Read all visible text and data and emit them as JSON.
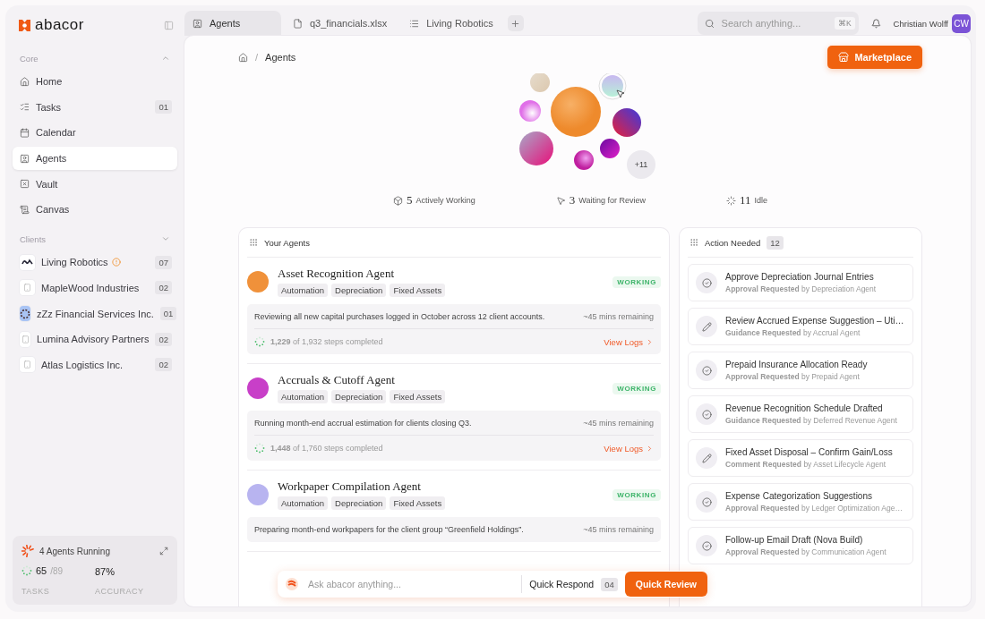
{
  "brand": {
    "name": "abacor"
  },
  "sidebar": {
    "sections": [
      {
        "title": "Core",
        "expanded": true,
        "items": [
          {
            "kind": "home",
            "label": "Home",
            "selected": false
          },
          {
            "kind": "tasks",
            "label": "Tasks",
            "count": "01",
            "selected": false
          },
          {
            "kind": "calendar",
            "label": "Calendar",
            "selected": false
          },
          {
            "kind": "agents",
            "label": "Agents",
            "selected": true
          },
          {
            "kind": "vault",
            "label": "Vault",
            "selected": false
          },
          {
            "kind": "canvas",
            "label": "Canvas",
            "selected": false
          }
        ]
      },
      {
        "title": "Clients",
        "expanded": false,
        "items": [
          {
            "kind": "wave",
            "label": "Living Robotics",
            "alert": true,
            "count": "07",
            "selected": false
          },
          {
            "kind": "building",
            "label": "MapleWood Industries",
            "alert": false,
            "count": "02",
            "selected": false
          },
          {
            "kind": "brand",
            "label": "zZz Financial Services Inc.",
            "alert": false,
            "count": "01",
            "selected": false
          },
          {
            "kind": "building",
            "label": "Lumina Advisory Partners",
            "alert": false,
            "count": "02",
            "selected": false
          },
          {
            "kind": "building",
            "label": "Atlas Logistics Inc.",
            "alert": false,
            "count": "02",
            "selected": false
          }
        ]
      }
    ],
    "running": {
      "title": "4 Agents Running",
      "tasks_done": "65",
      "tasks_total": "/89",
      "tasks_label": "TASKS",
      "accuracy": "87%",
      "accuracy_label": "ACCURACY"
    }
  },
  "tabs": [
    {
      "kind": "agents",
      "label": "Agents",
      "selected": true
    },
    {
      "kind": "file",
      "label": "q3_financials.xlsx",
      "selected": false
    },
    {
      "kind": "list",
      "label": "Living Robotics",
      "selected": false
    }
  ],
  "search": {
    "placeholder": "Search anything...",
    "shortcut": "⌘K"
  },
  "user": {
    "name": "Christian Wolff",
    "initials": "CW"
  },
  "breadcrumb": {
    "separator": "/",
    "items": [
      "Agents"
    ]
  },
  "marketplace_button": "Marketplace",
  "cluster": {
    "more": "+11"
  },
  "stats": [
    {
      "kind": "working",
      "count": "5",
      "label": "Actively Working"
    },
    {
      "kind": "review",
      "count": "3",
      "label": "Waiting for Review"
    },
    {
      "kind": "idle",
      "count": "11",
      "label": "Idle"
    }
  ],
  "agents_panel": {
    "title": "Your Agents",
    "agents": [
      {
        "name": "Asset Recognition Agent",
        "color": "#f0913a",
        "tags": [
          "Automation",
          "Depreciation",
          "Fixed Assets"
        ],
        "status": "WORKING",
        "description": "Reviewing all new capital purchases logged in October across 12 client accounts.",
        "remaining": "~45 mins remaining",
        "steps": "**1,229** of 1,932 steps completed",
        "link": "View Logs"
      },
      {
        "name": "Accruals & Cutoff Agent",
        "color": "#c83fc8",
        "tags": [
          "Automation",
          "Depreciation",
          "Fixed Assets"
        ],
        "status": "WORKING",
        "description": "Running month-end accrual estimation for clients closing Q3.",
        "remaining": "~45 mins remaining",
        "steps": "**1,448** of 1,760 steps completed",
        "link": "View Logs"
      },
      {
        "name": "Workpaper Compilation Agent",
        "color": "#b8b4f0",
        "tags": [
          "Automation",
          "Depreciation",
          "Fixed Assets"
        ],
        "status": "WORKING",
        "description": "Preparing month-end workpapers for the client group “Greenfield Holdings”.",
        "remaining": "~45 mins remaining"
      }
    ]
  },
  "actions_panel": {
    "title": "Action Needed",
    "count": "12",
    "items": [
      {
        "kind": "approve",
        "title": "Approve Depreciation Journal Entries",
        "subtitle": "**Approval Requested** by Depreciation Agent"
      },
      {
        "kind": "edit",
        "title": "Review Accrued Expense Suggestion – Uti…",
        "subtitle": "**Guidance Requested** by Accrual Agent"
      },
      {
        "kind": "approve",
        "title": "Prepaid Insurance Allocation Ready",
        "subtitle": "**Approval Requested** by Prepaid Agent"
      },
      {
        "kind": "approve",
        "title": "Revenue Recognition Schedule Drafted",
        "subtitle": "**Guidance Requested** by Deferred Revenue Agent"
      },
      {
        "kind": "edit",
        "title": "Fixed Asset Disposal – Confirm Gain/Loss",
        "subtitle": "**Comment Requested** by Asset Lifecycle Agent"
      },
      {
        "kind": "approve",
        "title": "Expense Categorization Suggestions",
        "subtitle": "**Approval Requested** by Ledger Optimization Age…"
      },
      {
        "kind": "approve",
        "title": "Follow-up Email Draft (Nova Build)",
        "subtitle": "**Approval Requested** by Communication Agent"
      }
    ]
  },
  "quick_bar": {
    "placeholder": "Ask abacor anything...",
    "respond_label": "Quick Respond",
    "respond_count": "04",
    "review_button": "Quick Review"
  }
}
